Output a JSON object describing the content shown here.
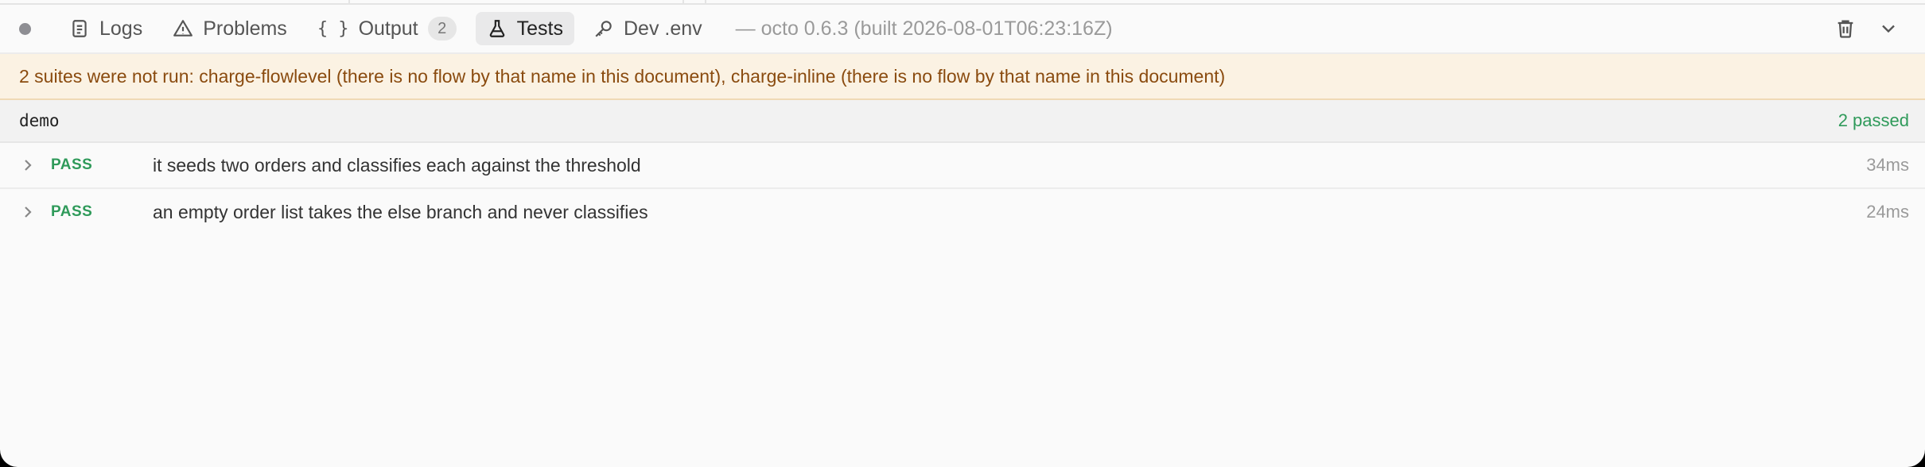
{
  "toolbar": {
    "tabs": [
      {
        "label": "Logs",
        "icon": "logs-icon",
        "active": false
      },
      {
        "label": "Problems",
        "icon": "warning-triangle-icon",
        "active": false
      },
      {
        "label": "Output",
        "icon": "braces-icon",
        "glyph": "{ }",
        "active": false,
        "badge": "2"
      },
      {
        "label": "Tests",
        "icon": "flask-icon",
        "active": true
      },
      {
        "label": "Dev .env",
        "icon": "key-icon",
        "active": false
      }
    ],
    "version": "— octo 0.6.3 (built 2026-08-01T06:23:16Z)",
    "status_dot_color": "#8e8e93"
  },
  "warning": {
    "text": "2 suites were not run: charge-flowlevel (there is no flow by that name in this document), charge-inline (there is no flow by that name in this document)"
  },
  "suite": {
    "name": "demo",
    "summary": "2 passed",
    "tests": [
      {
        "status": "PASS",
        "name": "it seeds two orders and classifies each against the threshold",
        "duration": "34ms"
      },
      {
        "status": "PASS",
        "name": "an empty order list takes the else branch and never classifies",
        "duration": "24ms"
      }
    ]
  },
  "colors": {
    "pass": "#2f9a5a",
    "warning_bg": "#fbf2e3",
    "warning_text": "#8a4b0f"
  }
}
